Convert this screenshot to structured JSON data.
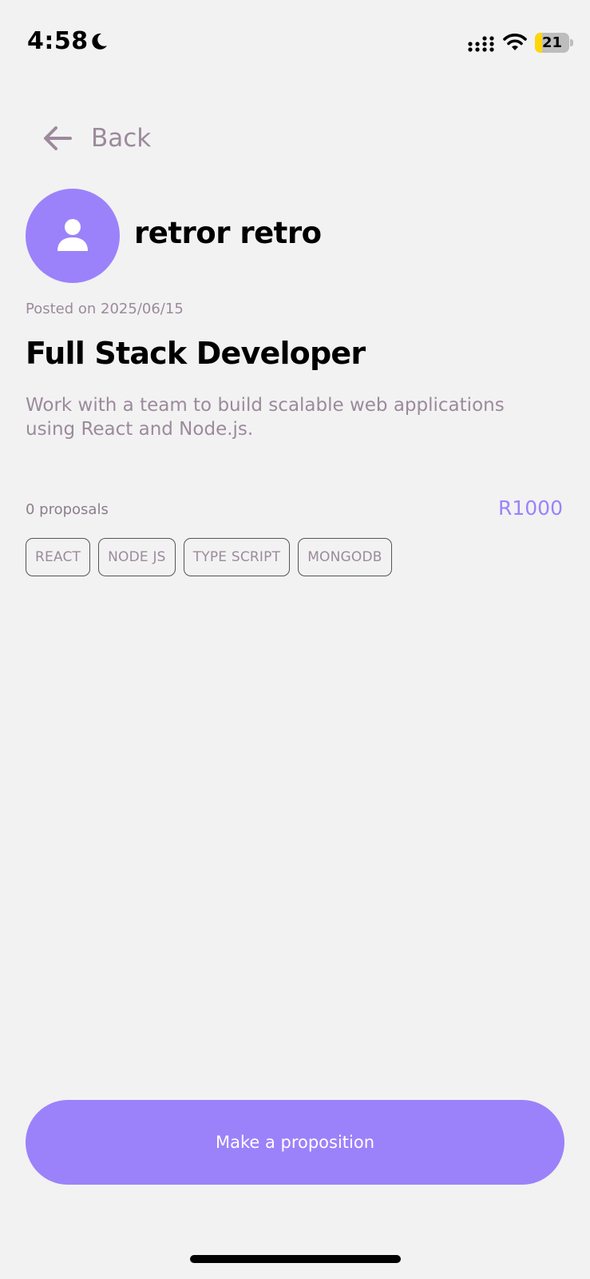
{
  "status_bar": {
    "time": "4:58",
    "battery_level": "21",
    "battery_percent": 21,
    "icons": [
      "moon-icon",
      "signal-icon",
      "wifi-icon",
      "battery-icon"
    ]
  },
  "nav": {
    "back_label": "Back",
    "back_icon": "arrow-left-icon"
  },
  "profile": {
    "name": "retror retro",
    "avatar_icon": "user-icon"
  },
  "job": {
    "posted_on": "Posted on 2025/06/15",
    "title": "Full Stack Developer",
    "description": "Work with a team to build scalable web applications using React and Node.js.",
    "proposals": "0 proposals",
    "price": "R1000",
    "tags": [
      "REACT",
      "NODE JS",
      "TYPE SCRIPT",
      "MONGODB"
    ]
  },
  "actions": {
    "make_proposition_label": "Make a proposition"
  },
  "colors": {
    "background": "#f2f2f2",
    "accent": "#9b82fa",
    "muted_text": "#9c8a9c",
    "battery_yellow": "#ffd60a"
  }
}
